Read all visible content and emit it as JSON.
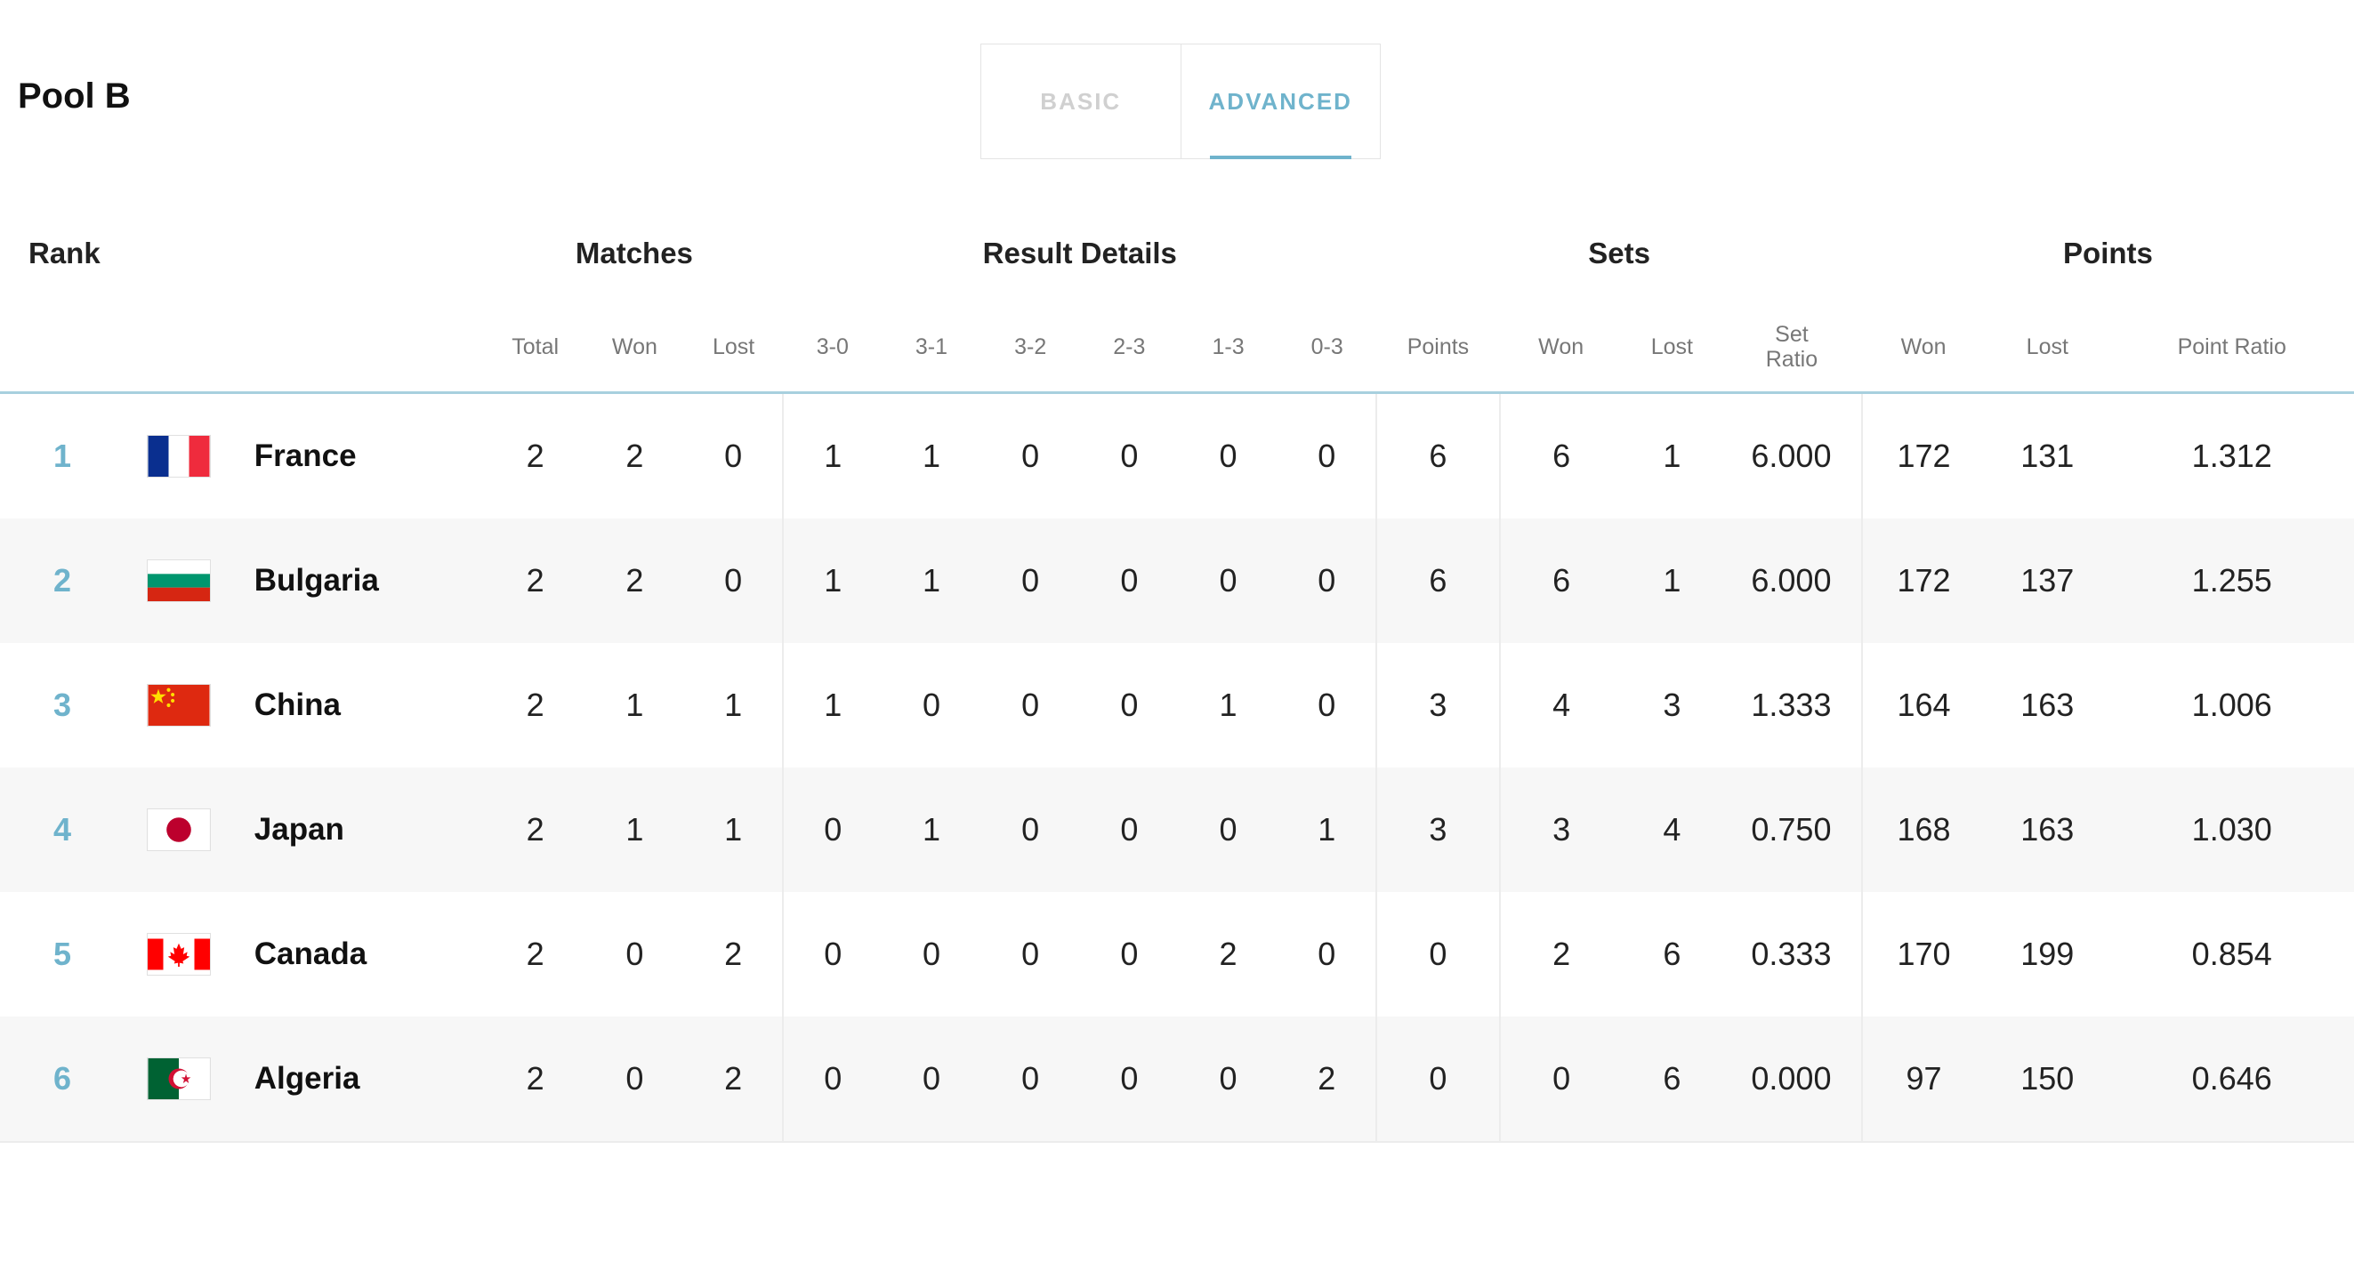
{
  "header": {
    "pool_title": "Pool B"
  },
  "tabs": [
    {
      "label": "BASIC",
      "active": false
    },
    {
      "label": "ADVANCED",
      "active": true
    }
  ],
  "colors": {
    "accent": "#6fb3cc",
    "row_alt": "#f7f7f7"
  },
  "table": {
    "groups": {
      "rank": "Rank",
      "matches": "Matches",
      "result_details": "Result Details",
      "sets": "Sets",
      "points": "Points"
    },
    "columns": {
      "total": "Total",
      "won": "Won",
      "lost": "Lost",
      "r30": "3-0",
      "r31": "3-1",
      "r32": "3-2",
      "r23": "2-3",
      "r13": "1-3",
      "r03": "0-3",
      "points": "Points",
      "sets_won": "Won",
      "sets_lost": "Lost",
      "set_ratio": "Set Ratio",
      "pts_won": "Won",
      "pts_lost": "Lost",
      "point_ratio": "Point Ratio"
    },
    "rows": [
      {
        "rank": "1",
        "flag": "france-flag-icon",
        "team": "France",
        "total": "2",
        "won": "2",
        "lost": "0",
        "r30": "1",
        "r31": "1",
        "r32": "0",
        "r23": "0",
        "r13": "0",
        "r03": "0",
        "points": "6",
        "sets_won": "6",
        "sets_lost": "1",
        "set_ratio": "6.000",
        "pts_won": "172",
        "pts_lost": "131",
        "point_ratio": "1.312"
      },
      {
        "rank": "2",
        "flag": "bulgaria-flag-icon",
        "team": "Bulgaria",
        "total": "2",
        "won": "2",
        "lost": "0",
        "r30": "1",
        "r31": "1",
        "r32": "0",
        "r23": "0",
        "r13": "0",
        "r03": "0",
        "points": "6",
        "sets_won": "6",
        "sets_lost": "1",
        "set_ratio": "6.000",
        "pts_won": "172",
        "pts_lost": "137",
        "point_ratio": "1.255"
      },
      {
        "rank": "3",
        "flag": "china-flag-icon",
        "team": "China",
        "total": "2",
        "won": "1",
        "lost": "1",
        "r30": "1",
        "r31": "0",
        "r32": "0",
        "r23": "0",
        "r13": "1",
        "r03": "0",
        "points": "3",
        "sets_won": "4",
        "sets_lost": "3",
        "set_ratio": "1.333",
        "pts_won": "164",
        "pts_lost": "163",
        "point_ratio": "1.006"
      },
      {
        "rank": "4",
        "flag": "japan-flag-icon",
        "team": "Japan",
        "total": "2",
        "won": "1",
        "lost": "1",
        "r30": "0",
        "r31": "1",
        "r32": "0",
        "r23": "0",
        "r13": "0",
        "r03": "1",
        "points": "3",
        "sets_won": "3",
        "sets_lost": "4",
        "set_ratio": "0.750",
        "pts_won": "168",
        "pts_lost": "163",
        "point_ratio": "1.030"
      },
      {
        "rank": "5",
        "flag": "canada-flag-icon",
        "team": "Canada",
        "total": "2",
        "won": "0",
        "lost": "2",
        "r30": "0",
        "r31": "0",
        "r32": "0",
        "r23": "0",
        "r13": "2",
        "r03": "0",
        "points": "0",
        "sets_won": "2",
        "sets_lost": "6",
        "set_ratio": "0.333",
        "pts_won": "170",
        "pts_lost": "199",
        "point_ratio": "0.854"
      },
      {
        "rank": "6",
        "flag": "algeria-flag-icon",
        "team": "Algeria",
        "total": "2",
        "won": "0",
        "lost": "2",
        "r30": "0",
        "r31": "0",
        "r32": "0",
        "r23": "0",
        "r13": "0",
        "r03": "2",
        "points": "0",
        "sets_won": "0",
        "sets_lost": "6",
        "set_ratio": "0.000",
        "pts_won": "97",
        "pts_lost": "150",
        "point_ratio": "0.646"
      }
    ]
  }
}
